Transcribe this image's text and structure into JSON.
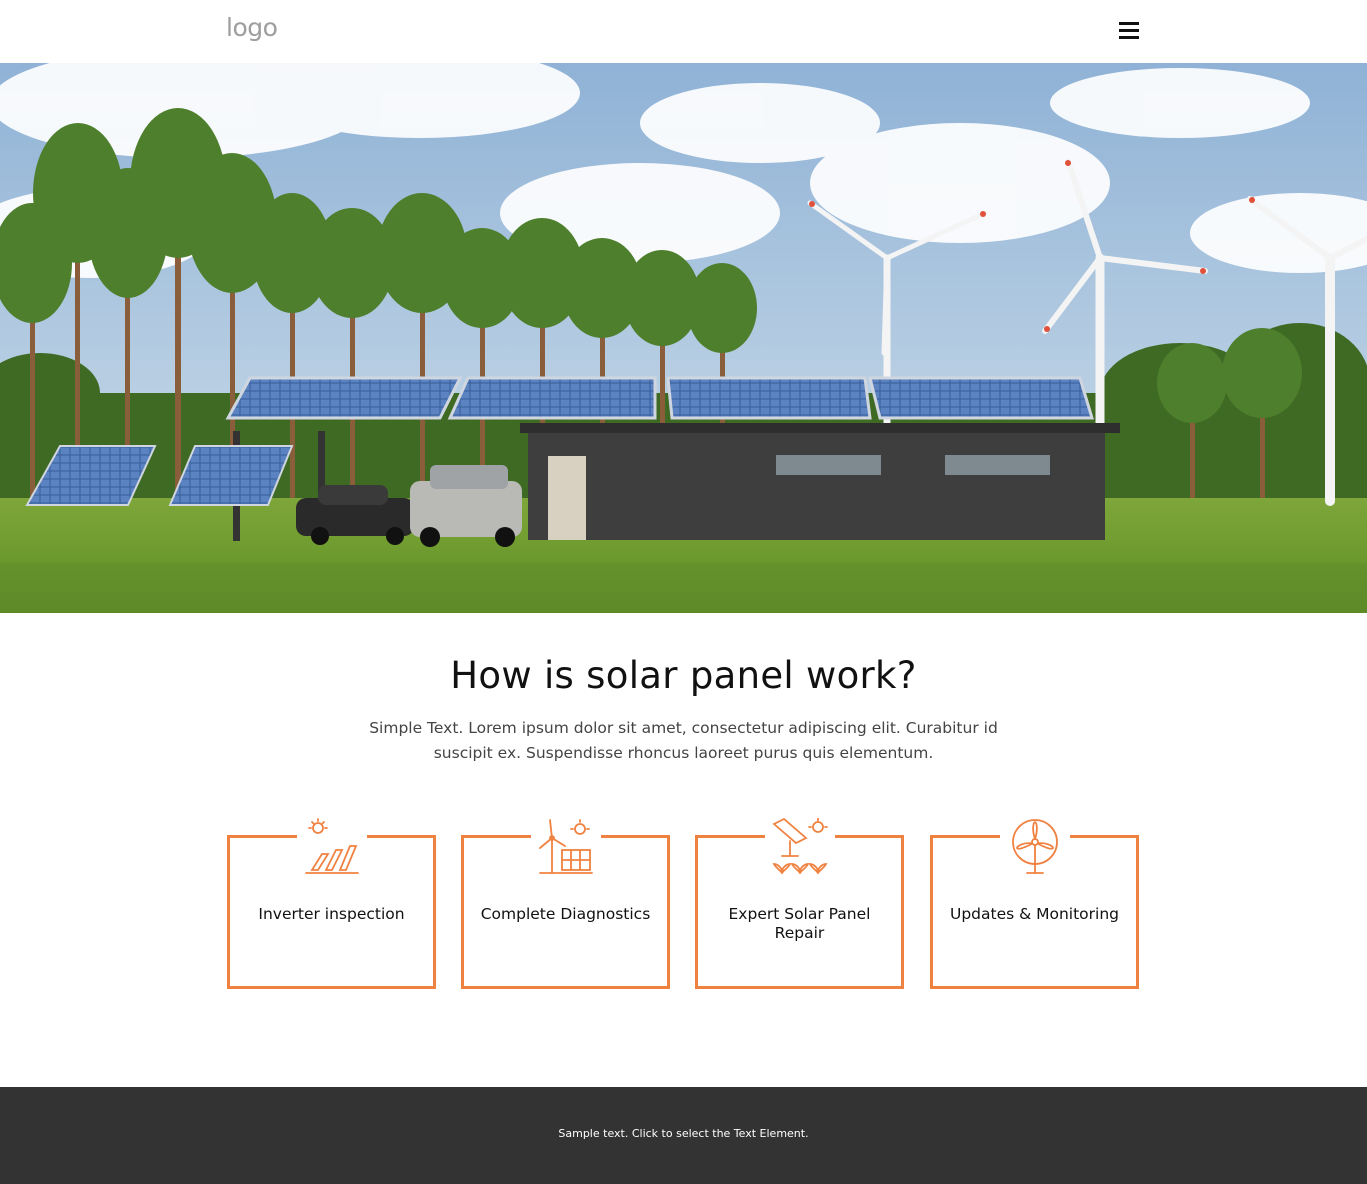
{
  "header": {
    "logo_text": "logo",
    "menu_icon": "hamburger-menu-icon"
  },
  "hero": {
    "image_subject": "solar panels and wind turbines"
  },
  "intro": {
    "title": "How is solar panel work?",
    "text": "Simple Text. Lorem ipsum dolor sit amet, consectetur adipiscing elit. Curabitur id suscipit ex. Suspendisse rhoncus laoreet purus quis elementum."
  },
  "services": [
    {
      "label": "Inverter inspection",
      "icon": "solar-panel-sun-icon"
    },
    {
      "label": "Complete Diagnostics",
      "icon": "wind-turbine-solar-panel-icon"
    },
    {
      "label": "Expert Solar Panel Repair",
      "icon": "solar-panel-plants-icon"
    },
    {
      "label": "Updates & Monitoring",
      "icon": "wind-turbine-circle-icon"
    }
  ],
  "footer": {
    "text": "Sample text. Click to select the Text Element."
  },
  "colors": {
    "accent": "#f08241",
    "footer_bg": "#333333",
    "logo": "#9e9e9e"
  }
}
